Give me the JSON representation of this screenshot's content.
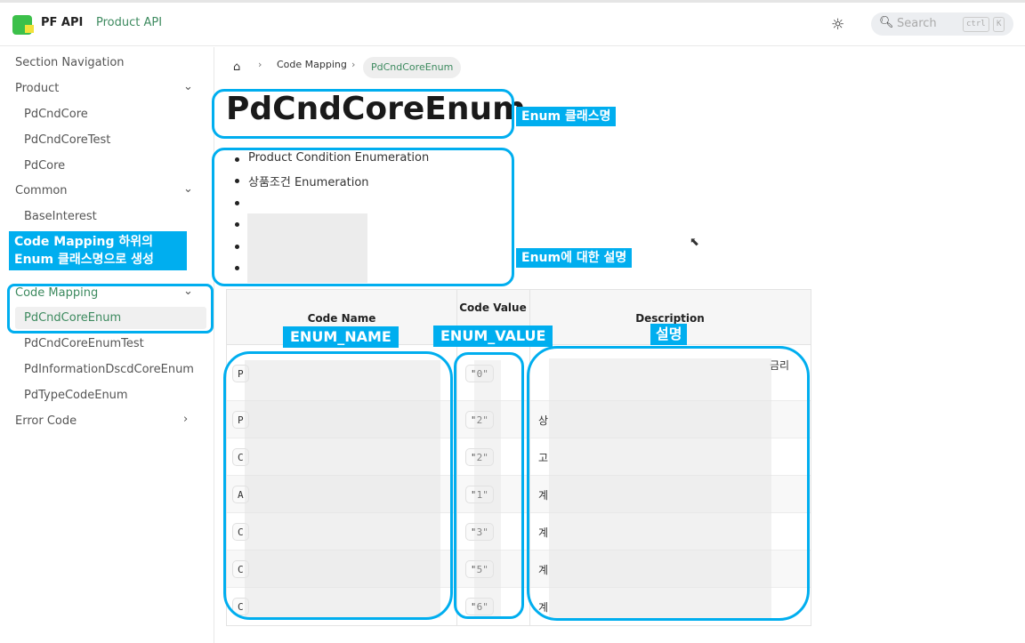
{
  "header": {
    "brand": "PF API",
    "product_link": "Product API",
    "theme_icon": "sun-icon",
    "search": {
      "placeholder": "Search",
      "key1": "ctrl",
      "key2": "K"
    }
  },
  "sidebar": {
    "section_title": "Section Navigation",
    "groups": [
      {
        "label": "Product",
        "expanded": true,
        "items": [
          "PdCndCore",
          "PdCndCoreTest",
          "PdCore"
        ]
      },
      {
        "label": "Common",
        "expanded": true,
        "items": [
          "BaseInterest"
        ]
      },
      {
        "label": "Code Mapping",
        "expanded": true,
        "items": [
          "PdCndCoreEnum",
          "PdCndCoreEnumTest",
          "PdInformationDscdCoreEnum",
          "PdTypeCodeEnum"
        ]
      },
      {
        "label": "Error Code",
        "expanded": false,
        "items": []
      }
    ],
    "active_item": "PdCndCoreEnum"
  },
  "breadcrumb": {
    "items": [
      "Code Mapping",
      "PdCndCoreEnum"
    ]
  },
  "page": {
    "title": "PdCndCoreEnum",
    "bullets": [
      "Product Condition Enumeration",
      "상품조건 Enumeration",
      "",
      "",
      "",
      ""
    ]
  },
  "table": {
    "headers": [
      "Code Name",
      "Code Value",
      "Description"
    ],
    "rows": [
      {
        "name": "P",
        "value": "\"0\"",
        "desc": "금리"
      },
      {
        "name": "P",
        "value": "\"2\"",
        "desc": "상"
      },
      {
        "name": "C",
        "value": "\"2\"",
        "desc": "고"
      },
      {
        "name": "A",
        "value": "\"1\"",
        "desc": "계"
      },
      {
        "name": "C",
        "value": "\"3\"",
        "desc": "계"
      },
      {
        "name": "C",
        "value": "\"5\"",
        "desc": "계"
      },
      {
        "name": "C",
        "value": "\"6\"",
        "desc": "계"
      }
    ]
  },
  "annotations": {
    "class_name": "Enum 클래스명",
    "description": "Enum에 대한 설명",
    "sidebar_note_line1": "Code Mapping 하위의",
    "sidebar_note_line2": "Enum 클래스명으로 생성",
    "enum_name": "ENUM_NAME",
    "enum_value": "ENUM_VALUE",
    "desc": "설명",
    "color": "#00aeef"
  }
}
